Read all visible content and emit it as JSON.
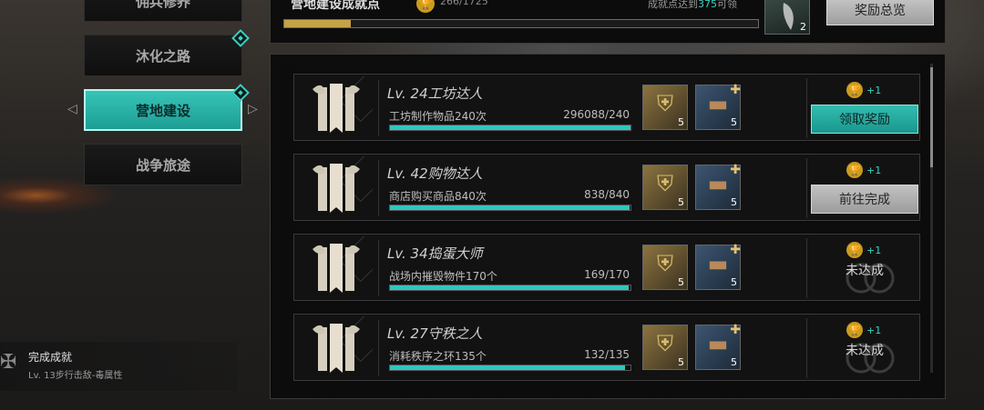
{
  "sidebar": {
    "tabs": [
      {
        "label": "佣兵修养"
      },
      {
        "label": "沐化之路"
      },
      {
        "label": "营地建设"
      },
      {
        "label": "战争旅途"
      }
    ],
    "recent": {
      "title": "完成成就",
      "subtitle": "Lv. 13步行击敌-毒属性"
    }
  },
  "header": {
    "title": "营地建设成就点",
    "count": "266/1725",
    "hint_prefix": "成就点达到",
    "hint_value": "375",
    "hint_suffix": "可领",
    "progress": 0.14,
    "item_count": "2",
    "overview_button": "奖励总览"
  },
  "achievements": [
    {
      "title": "Lv. 24工坊达人",
      "desc": "工坊制作物品240次",
      "progress_text": "296088/240",
      "progress": 1.0,
      "reward_points": "+1",
      "item1": "5",
      "item2": "5",
      "action": "领取奖励",
      "state": "claim"
    },
    {
      "title": "Lv. 42购物达人",
      "desc": "商店购买商品840次",
      "progress_text": "838/840",
      "progress": 0.998,
      "reward_points": "+1",
      "item1": "5",
      "item2": "5",
      "action": "前往完成",
      "state": "go"
    },
    {
      "title": "Lv. 34捣蛋大师",
      "desc": "战场内摧毁物件170个",
      "progress_text": "169/170",
      "progress": 0.994,
      "reward_points": "+1",
      "item1": "5",
      "item2": "5",
      "action": "未达成",
      "state": "incomplete"
    },
    {
      "title": "Lv. 27守秩之人",
      "desc": "消耗秩序之环135个",
      "progress_text": "132/135",
      "progress": 0.978,
      "reward_points": "+1",
      "item1": "5",
      "item2": "5",
      "action": "未达成",
      "state": "incomplete"
    }
  ],
  "colors": {
    "accent": "#2fc7c0",
    "gold": "#c99b1f"
  }
}
